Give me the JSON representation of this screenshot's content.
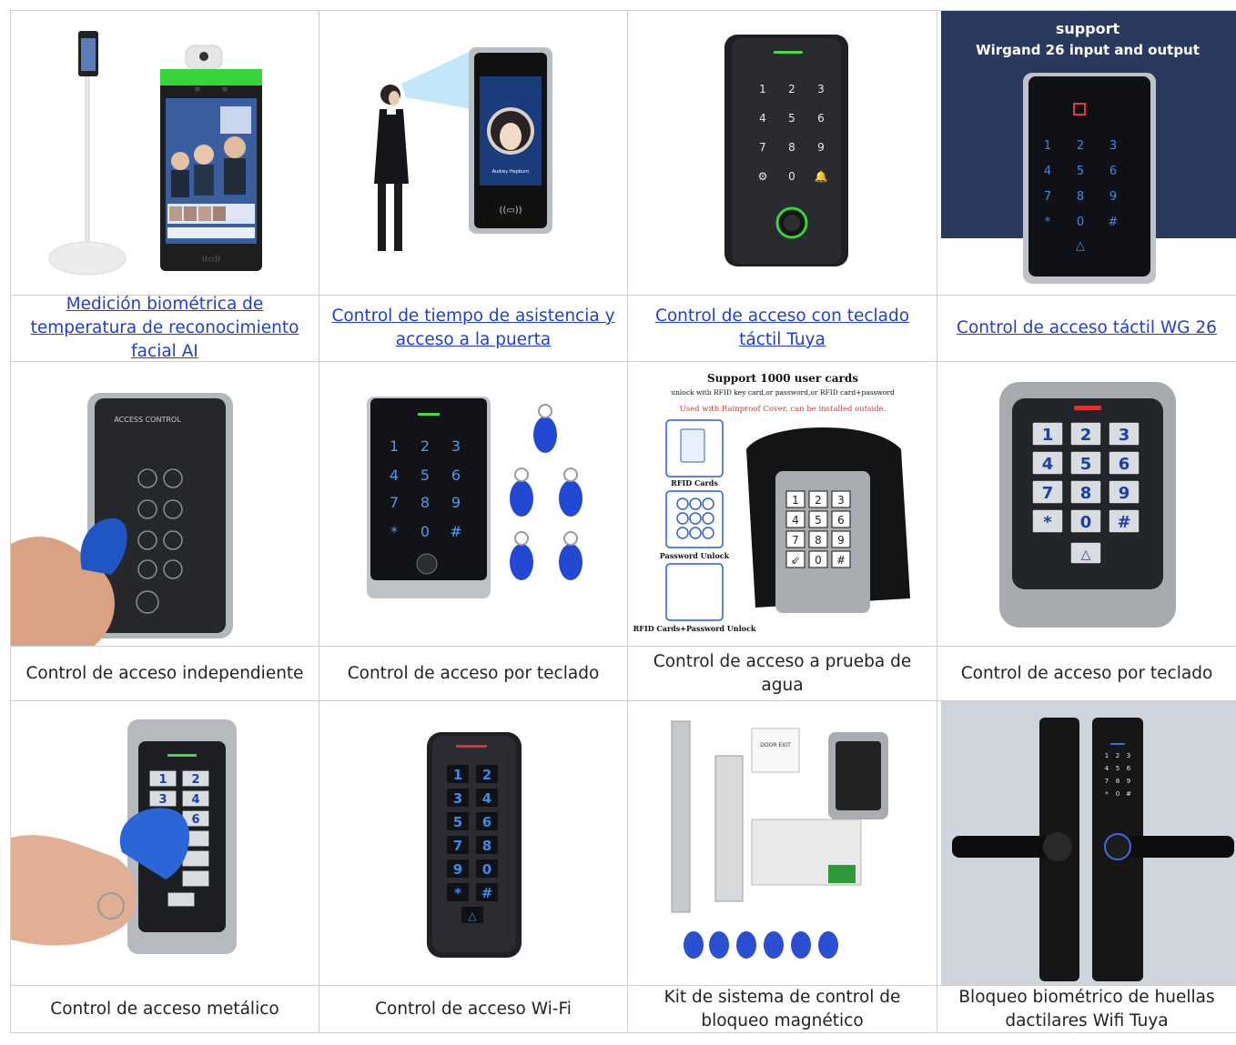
{
  "products": [
    {
      "caption": "Medición biométrica de temperatura de reconocimiento facial AI",
      "link": true
    },
    {
      "caption": "Control de tiempo de asistencia y acceso a la puerta",
      "link": true
    },
    {
      "caption": "Control de acceso con teclado táctil Tuya",
      "link": true
    },
    {
      "caption": "Control de acceso táctil WG 26",
      "link": true
    },
    {
      "caption": "Control de acceso independiente",
      "link": false
    },
    {
      "caption": "Control de acceso por teclado",
      "link": false
    },
    {
      "caption": "Control de acceso a prueba de agua",
      "link": false
    },
    {
      "caption": "Control de acceso por teclado",
      "link": false
    },
    {
      "caption": "Control de acceso metálico",
      "link": false
    },
    {
      "caption": "Control de acceso Wi-Fi",
      "link": false
    },
    {
      "caption": "Kit de sistema de control de bloqueo magnético",
      "link": false
    },
    {
      "caption": "Bloqueo biométrico de huellas dactilares Wifi Tuya",
      "link": false
    }
  ],
  "image_text": {
    "wg26_line1": "support",
    "wg26_line2": "Wirgand 26 input and output",
    "waterproof_title": "Support 1000 user cards",
    "waterproof_sub": "unlock with RFID key card,or password,or RFID card+password",
    "waterproof_red": "Used with Rainproof Cover, can be installed outside.",
    "rfid_cards": "RFID Cards",
    "password_unlock": "Password Unlock",
    "rfid_password": "RFID Cards+Password Unlock",
    "access_control": "ACCESS CONTROL",
    "audrey": "Audrey Hepburn",
    "door_exit": "DOOR EXIT"
  },
  "colors": {
    "link": "#1f3fcc",
    "border": "#cfcfcf",
    "keypad_blue": "#2f7fe0",
    "fob_blue": "#1f4fd8"
  }
}
